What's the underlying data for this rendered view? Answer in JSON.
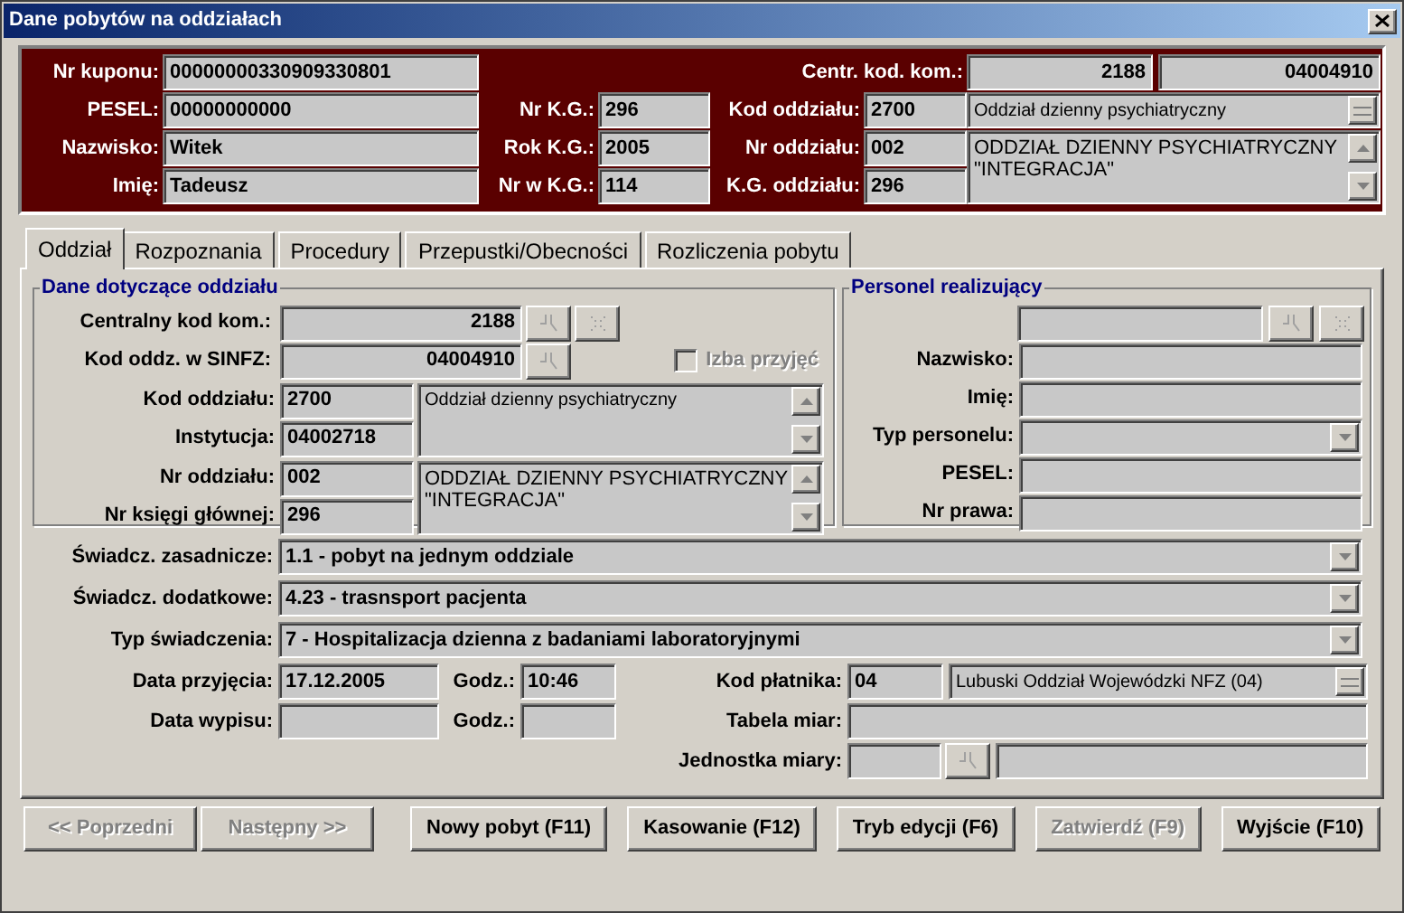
{
  "window": {
    "title": "Dane pobytów na oddziałach"
  },
  "header": {
    "patient_fields": [
      {
        "label": "Nr kuponu:",
        "value": "00000000330909330801"
      },
      {
        "label": "PESEL:",
        "value": "00000000000"
      },
      {
        "label": "Nazwisko:",
        "value": "Witek"
      },
      {
        "label": "Imię:",
        "value": "Tadeusz"
      }
    ],
    "central": {
      "label": "Centr. kod. kom.:",
      "values": [
        "2188",
        "04004910"
      ]
    },
    "kg_fields": [
      {
        "label": "Nr K.G.:",
        "value": "296"
      },
      {
        "label": "Rok K.G.:",
        "value": "2005"
      },
      {
        "label": "Nr w K.G.:",
        "value": "114"
      }
    ],
    "ward_fields": [
      {
        "label": "Kod oddziału:",
        "value": "2700"
      },
      {
        "label": "Nr oddziału:",
        "value": "002"
      },
      {
        "label": "K.G. oddziału:",
        "value": "296"
      }
    ],
    "ward_combo": "Oddział dzienny psychiatryczny",
    "ward_name": "ODDZIAŁ DZIENNY PSYCHIATRYCZNY\n\"INTEGRACJA\""
  },
  "tabs": [
    {
      "label": "Oddział",
      "selected": true
    },
    {
      "label": "Rozpoznania",
      "selected": false
    },
    {
      "label": "Procedury",
      "selected": false
    },
    {
      "label": "Przepustki/Obecności",
      "selected": false
    },
    {
      "label": "Rozliczenia pobytu",
      "selected": false
    }
  ],
  "department": {
    "title": "Dane dotyczące oddziału",
    "central": {
      "label": "Centralny kod kom.:",
      "value": "2188"
    },
    "sinfz": {
      "label": "Kod oddz. w SINFZ:",
      "value": "04004910"
    },
    "izba": {
      "label": "Izba przyjęć",
      "checked": false,
      "disabled": true
    },
    "fields": [
      {
        "label": "Kod oddziału:",
        "value": "2700"
      },
      {
        "label": "Instytucja:",
        "value": "04002718"
      },
      {
        "label": "Nr oddziału:",
        "value": "002"
      },
      {
        "label": "Nr księgi głównej:",
        "value": "296"
      }
    ],
    "descriptions": [
      "Oddział dzienny psychiatryczny",
      "ODDZIAŁ DZIENNY PSYCHIATRYCZNY\n\"INTEGRACJA\""
    ]
  },
  "personnel": {
    "title": "Personel realizujący",
    "fields": [
      {
        "label": "Nazwisko:",
        "kind": "text"
      },
      {
        "label": "Imię:",
        "kind": "text"
      },
      {
        "label": "Typ personelu:",
        "kind": "combo"
      },
      {
        "label": "PESEL:",
        "kind": "text"
      },
      {
        "label": "Nr prawa:",
        "kind": "text"
      }
    ]
  },
  "services": [
    {
      "label": "Świadcz. zasadnicze:",
      "value": "1.1 - pobyt na jednym oddziale"
    },
    {
      "label": "Świadcz. dodatkowe:",
      "value": "4.23 - trasnsport pacjenta"
    },
    {
      "label": "Typ świadczenia:",
      "value": "7 - Hospitalizacja dzienna z badaniami laboratoryjnymi"
    }
  ],
  "admission": {
    "label": "Data przyjęcia:",
    "value": "17.12.2005",
    "time_label": "Godz.:",
    "time_value": "10:46"
  },
  "discharge": {
    "label": "Data wypisu:",
    "time_label": "Godz.:"
  },
  "payer": {
    "label": "Kod płatnika:",
    "value": "04",
    "name": "Lubuski Oddział Wojewódzki NFZ (04)"
  },
  "measure_table": {
    "label": "Tabela miar:"
  },
  "measure_unit": {
    "label": "Jednostka miary:"
  },
  "buttons": [
    {
      "label": "<< Poprzedni",
      "kind": "nav",
      "disabled": true
    },
    {
      "label": "Następny >>",
      "kind": "nav",
      "disabled": true
    },
    {
      "label": "Nowy pobyt (F11)",
      "kind": "action",
      "disabled": false
    },
    {
      "label": "Kasowanie (F12)",
      "kind": "action",
      "disabled": false
    },
    {
      "label": "Tryb edycji (F6)",
      "kind": "action",
      "disabled": false
    },
    {
      "label": "Zatwierdź (F9)",
      "kind": "action",
      "disabled": true
    },
    {
      "label": "Wyjście (F10)",
      "kind": "action",
      "disabled": false
    }
  ]
}
